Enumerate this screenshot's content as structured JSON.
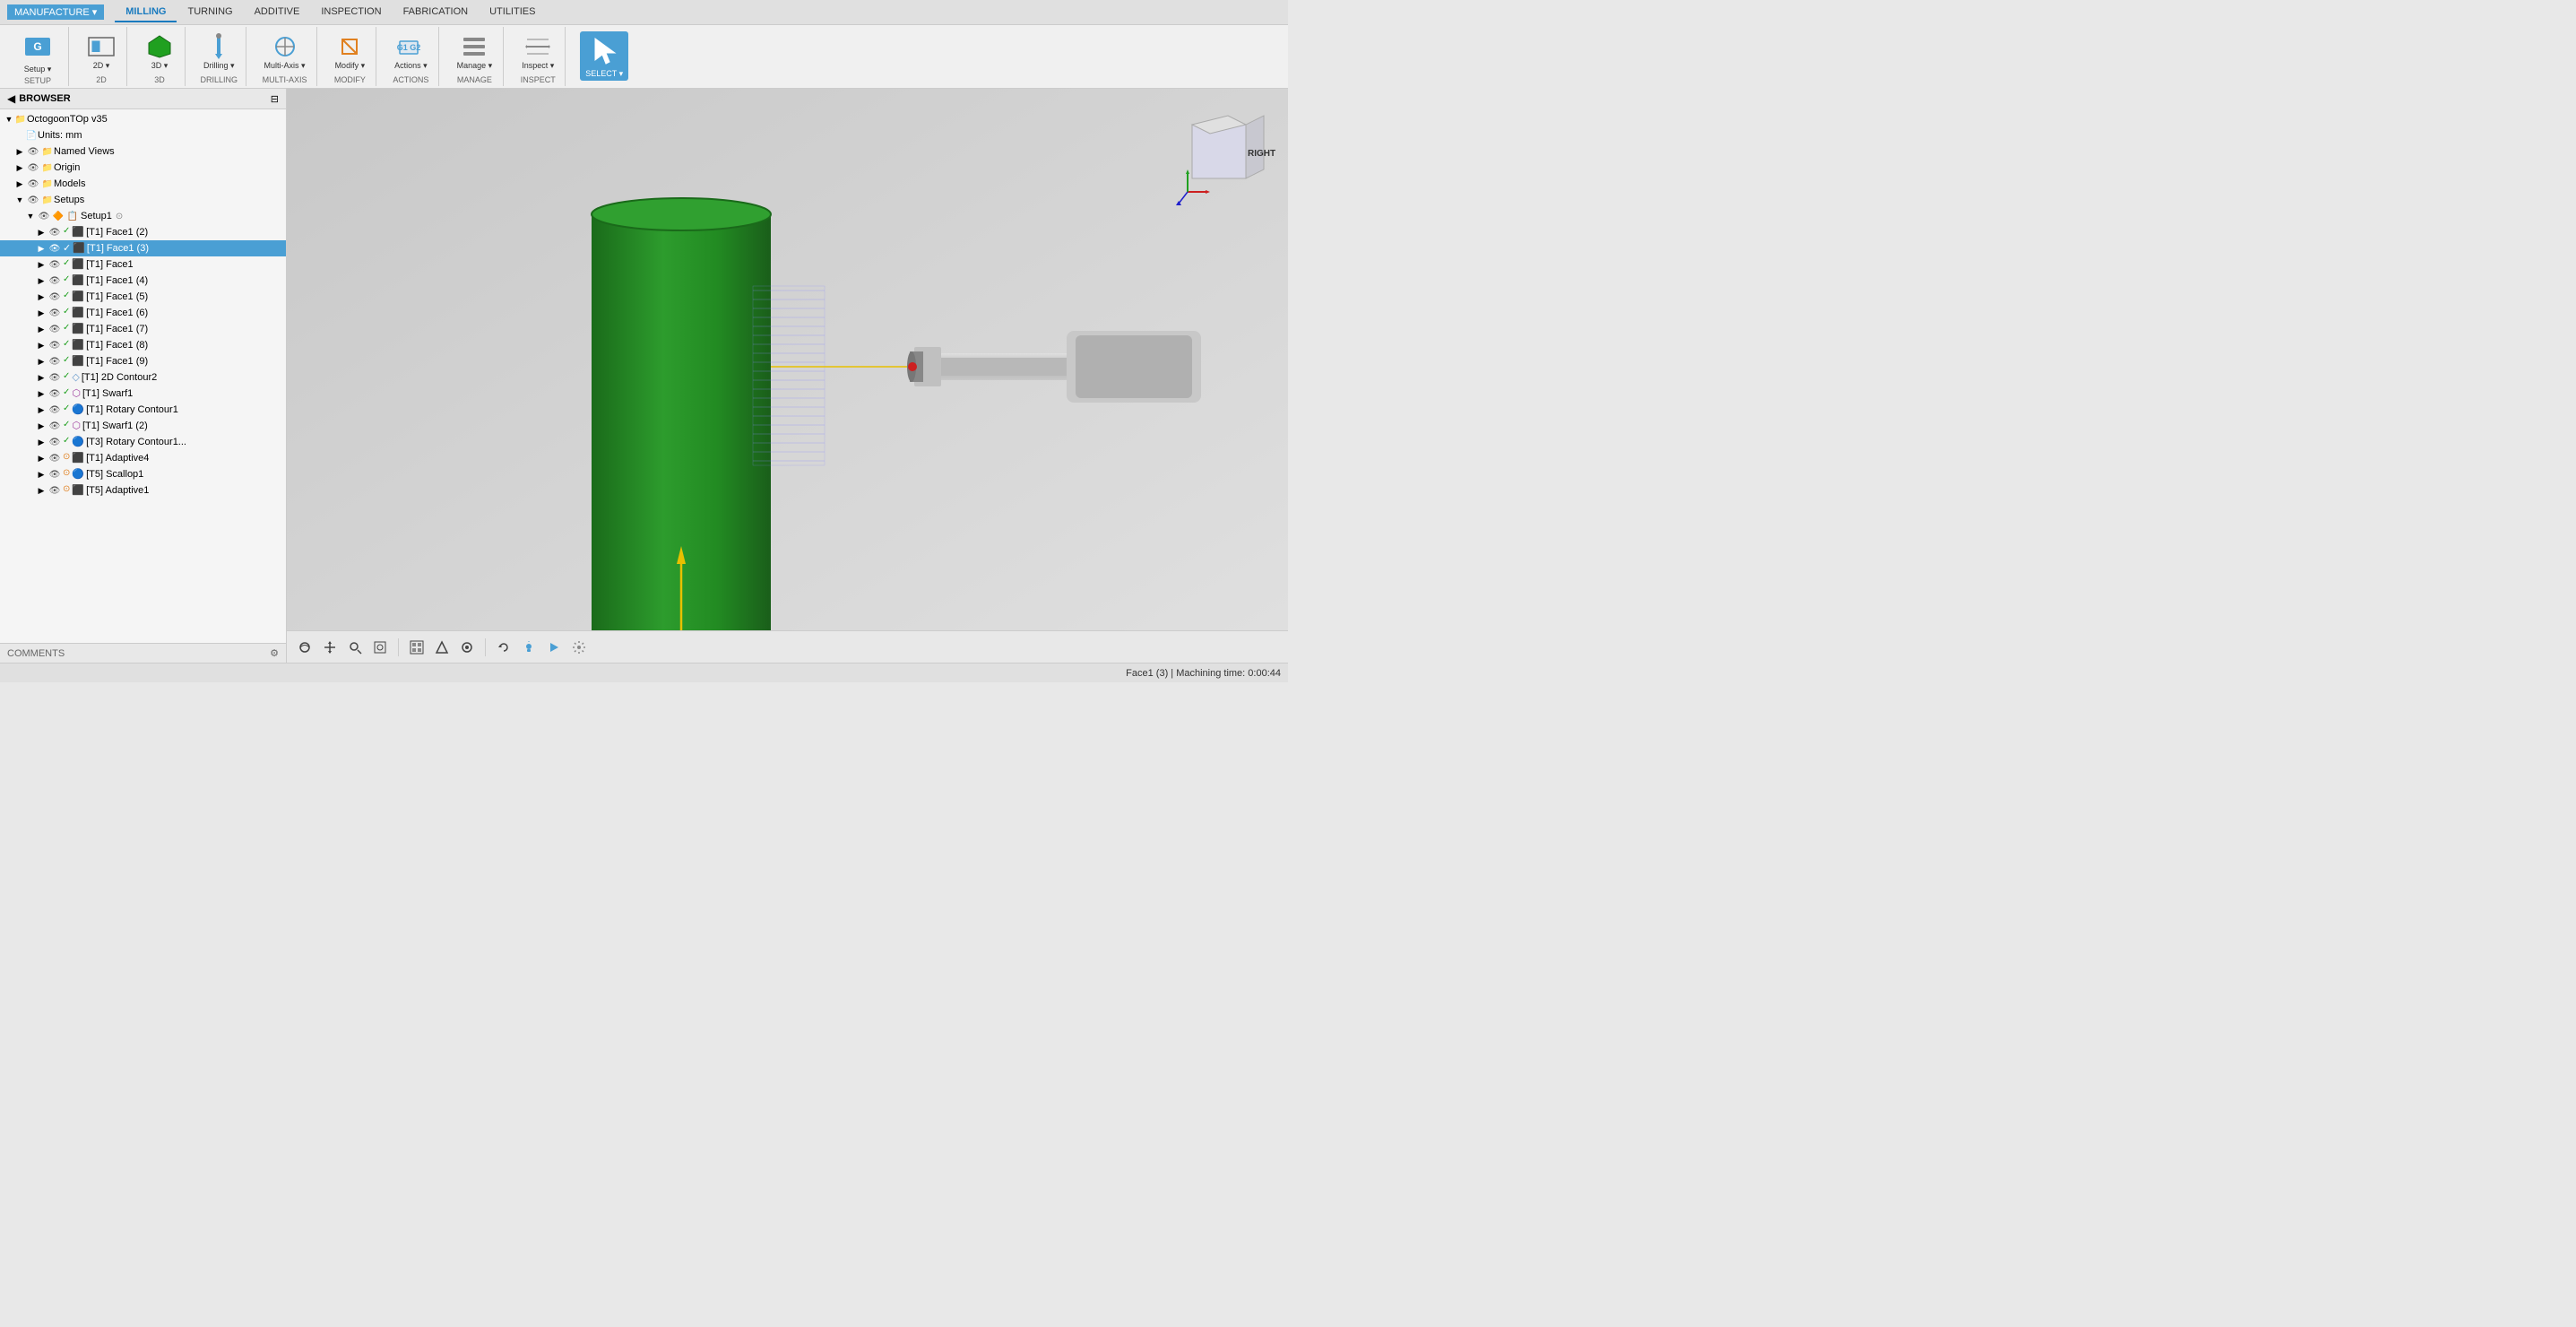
{
  "toolbar": {
    "manufacture_label": "MANUFACTURE",
    "tabs": [
      "MILLING",
      "TURNING",
      "ADDITIVE",
      "INSPECTION",
      "FABRICATION",
      "UTILITIES"
    ],
    "active_tab": "MILLING",
    "groups": {
      "setup": {
        "label": "SETUP",
        "items": [
          "Setup"
        ]
      },
      "2d": {
        "label": "2D",
        "items": [
          "2D"
        ]
      },
      "3d": {
        "label": "3D",
        "items": [
          "3D"
        ]
      },
      "drilling": {
        "label": "DRILLING",
        "items": [
          "Drilling"
        ]
      },
      "multiaxis": {
        "label": "MULTI-AXIS",
        "items": [
          "Multi-Axis"
        ]
      },
      "modify": {
        "label": "MODIFY",
        "items": [
          "Modify"
        ]
      },
      "actions": {
        "label": "ACTIONS",
        "items": [
          "Actions"
        ]
      },
      "manage": {
        "label": "MANAGE",
        "items": [
          "Manage"
        ]
      },
      "inspect": {
        "label": "INSPECT",
        "items": [
          "Inspect"
        ]
      },
      "select": {
        "label": "SELECT",
        "items": [
          "Select"
        ]
      }
    }
  },
  "browser": {
    "title": "BROWSER",
    "root_item": "OctogoonTOp v35",
    "items": [
      {
        "id": "units",
        "label": "Units: mm",
        "indent": 1,
        "selected": false
      },
      {
        "id": "named_views",
        "label": "Named Views",
        "indent": 1,
        "selected": false,
        "expandable": true
      },
      {
        "id": "origin",
        "label": "Origin",
        "indent": 1,
        "selected": false,
        "expandable": true
      },
      {
        "id": "models",
        "label": "Models",
        "indent": 1,
        "selected": false,
        "expandable": true
      },
      {
        "id": "setups",
        "label": "Setups",
        "indent": 1,
        "selected": false,
        "expandable": true,
        "expanded": true
      },
      {
        "id": "setup1",
        "label": "Setup1",
        "indent": 2,
        "selected": false,
        "expandable": true,
        "expanded": true
      },
      {
        "id": "face1_2",
        "label": "[T1] Face1 (2)",
        "indent": 3,
        "selected": false,
        "expandable": true
      },
      {
        "id": "face1_3",
        "label": "[T1] Face1 (3)",
        "indent": 3,
        "selected": true,
        "expandable": true
      },
      {
        "id": "face1",
        "label": "[T1] Face1",
        "indent": 3,
        "selected": false,
        "expandable": true
      },
      {
        "id": "face1_4",
        "label": "[T1] Face1 (4)",
        "indent": 3,
        "selected": false,
        "expandable": true
      },
      {
        "id": "face1_5",
        "label": "[T1] Face1 (5)",
        "indent": 3,
        "selected": false,
        "expandable": true
      },
      {
        "id": "face1_6",
        "label": "[T1] Face1 (6)",
        "indent": 3,
        "selected": false,
        "expandable": true
      },
      {
        "id": "face1_7",
        "label": "[T1] Face1 (7)",
        "indent": 3,
        "selected": false,
        "expandable": true
      },
      {
        "id": "face1_8",
        "label": "[T1] Face1 (8)",
        "indent": 3,
        "selected": false,
        "expandable": true
      },
      {
        "id": "face1_9",
        "label": "[T1] Face1 (9)",
        "indent": 3,
        "selected": false,
        "expandable": true
      },
      {
        "id": "contour2",
        "label": "[T1] 2D Contour2",
        "indent": 3,
        "selected": false,
        "expandable": true
      },
      {
        "id": "swarf1",
        "label": "[T1] Swarf1",
        "indent": 3,
        "selected": false,
        "expandable": true
      },
      {
        "id": "rotary1",
        "label": "[T1] Rotary Contour1",
        "indent": 3,
        "selected": false,
        "expandable": true
      },
      {
        "id": "swarf1_2",
        "label": "[T1] Swarf1 (2)",
        "indent": 3,
        "selected": false,
        "expandable": true
      },
      {
        "id": "rotary1_2",
        "label": "[T3] Rotary Contour1...",
        "indent": 3,
        "selected": false,
        "expandable": true
      },
      {
        "id": "adaptive4",
        "label": "[T1] Adaptive4",
        "indent": 3,
        "selected": false,
        "expandable": true
      },
      {
        "id": "scallop1",
        "label": "[T5] Scallop1",
        "indent": 3,
        "selected": false,
        "expandable": true
      },
      {
        "id": "adaptive1",
        "label": "[T5] Adaptive1",
        "indent": 3,
        "selected": false,
        "expandable": true
      }
    ],
    "footer": "COMMENTS"
  },
  "viewport": {
    "view_label": "RighT",
    "status": "Face1 (3) | Machining time: 0:00:44"
  },
  "view_cube": {
    "label": "RIGHT"
  }
}
